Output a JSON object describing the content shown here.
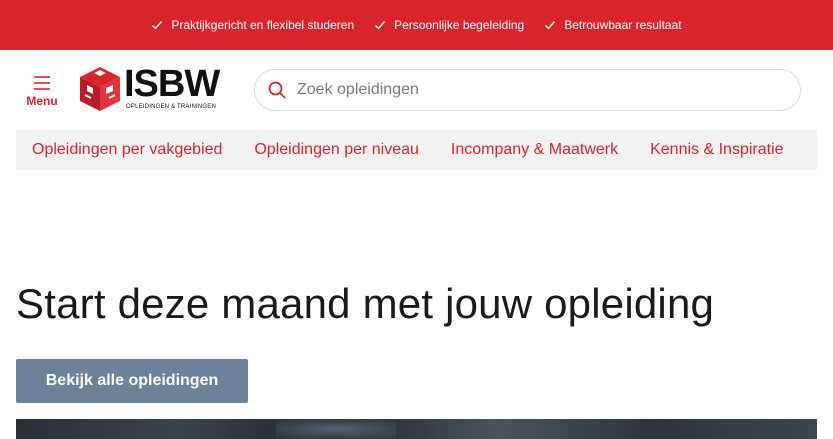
{
  "topbar": {
    "usps": [
      {
        "label": "Praktijkgericht en flexibel studeren"
      },
      {
        "label": "Persoonlijke begeleiding"
      },
      {
        "label": "Betrouwbaar resultaat"
      }
    ],
    "icon": "check-icon",
    "background": "#d8242d"
  },
  "header": {
    "menu_label": "Menu",
    "logo": {
      "word": "ISBW",
      "tagline": "OPLEIDINGEN & TRAININGEN"
    },
    "search": {
      "placeholder": "Zoek opleidingen",
      "value": ""
    }
  },
  "nav": {
    "items": [
      {
        "label": "Opleidingen per vakgebied"
      },
      {
        "label": "Opleidingen per niveau"
      },
      {
        "label": "Incompany & Maatwerk"
      },
      {
        "label": "Kennis & Inspiratie"
      }
    ]
  },
  "hero": {
    "title": "Start deze maand met jouw opleiding",
    "cta_label": "Bekijk alle opleidingen"
  },
  "colors": {
    "brand": "#d8242d",
    "cta": "#6b8299",
    "nav_bg": "#f2f2f2"
  }
}
